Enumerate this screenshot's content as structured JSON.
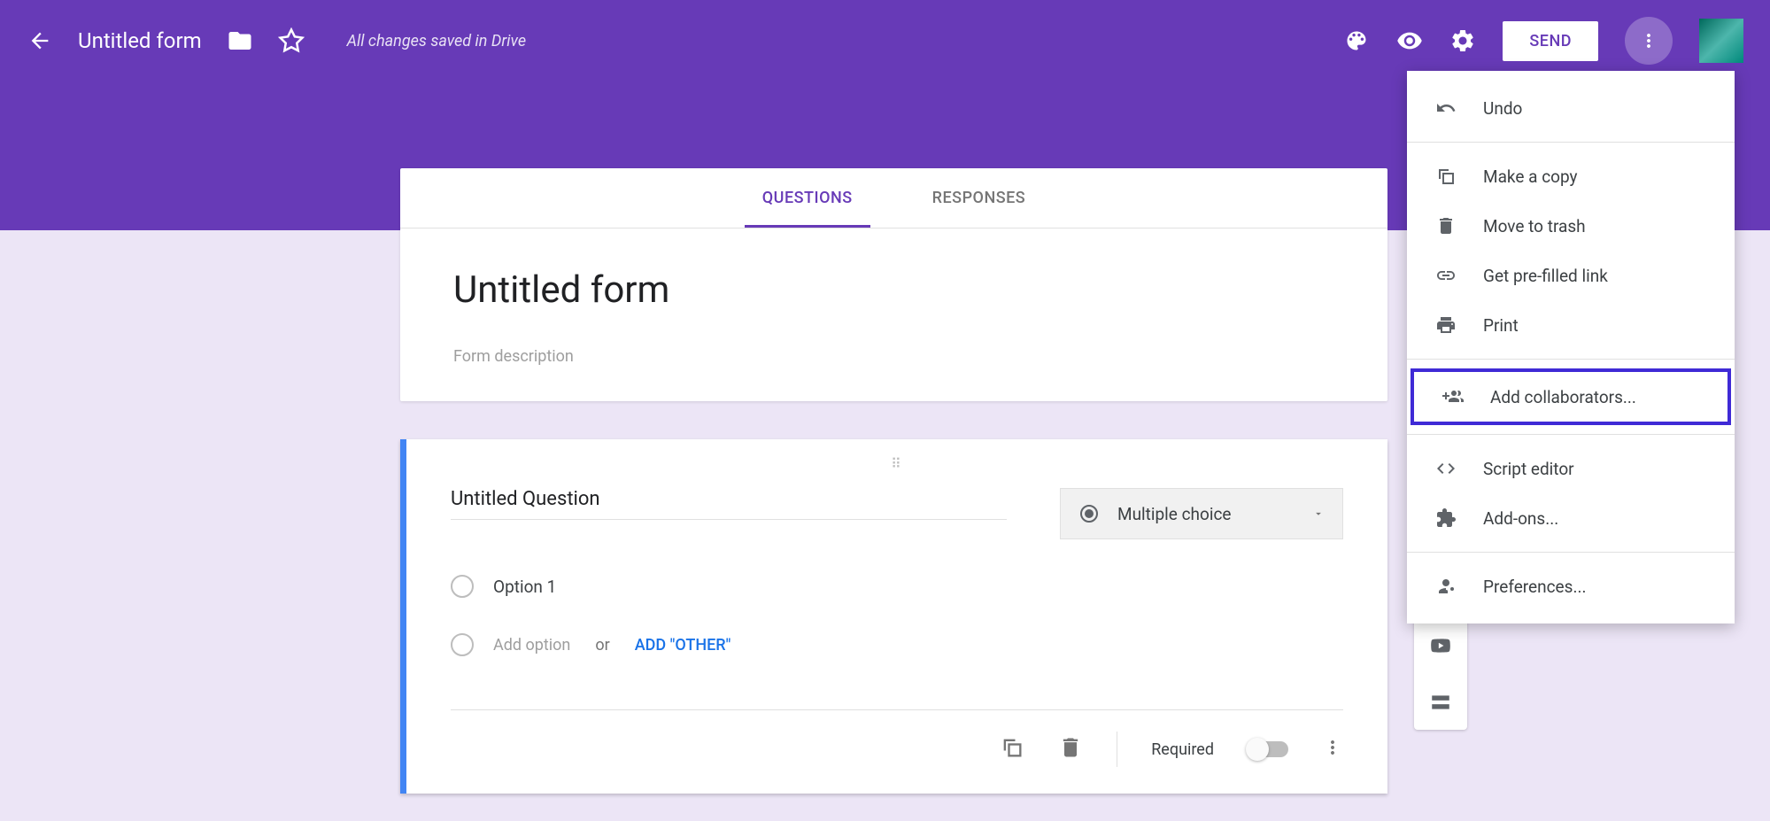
{
  "header": {
    "title": "Untitled form",
    "save_status": "All changes saved in Drive",
    "send_label": "SEND"
  },
  "tabs": {
    "questions": "QUESTIONS",
    "responses": "RESPONSES"
  },
  "form": {
    "title": "Untitled form",
    "description_placeholder": "Form description"
  },
  "question": {
    "title": "Untitled Question",
    "type_label": "Multiple choice",
    "option1": "Option 1",
    "add_option": "Add option",
    "or": "or",
    "add_other": "ADD \"OTHER\"",
    "required": "Required"
  },
  "menu": {
    "undo": "Undo",
    "copy": "Make a copy",
    "trash": "Move to trash",
    "prefill": "Get pre-filled link",
    "print": "Print",
    "collab": "Add collaborators...",
    "script": "Script editor",
    "addons": "Add-ons...",
    "prefs": "Preferences..."
  }
}
